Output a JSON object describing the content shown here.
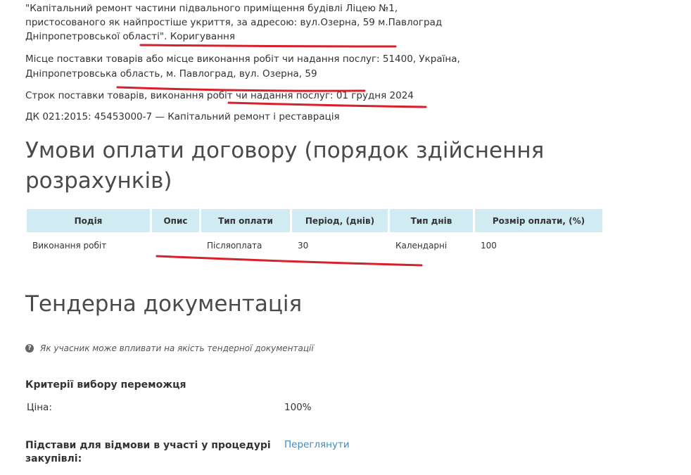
{
  "lot": {
    "title_line1": "\"Капітальний ремонт частини підвального приміщення будівлі Ліцею №1,",
    "title_line2": "пристосованого як найпростіше укриття, за адресою: вул.Озерна, 59 м.Павлоград",
    "title_line3": "Дніпропетровської області\". Коригування",
    "delivery_place_line1": "Місце поставки товарів або місце виконання робіт чи надання послуг: 51400, Україна,",
    "delivery_place_line2": "Дніпропетровська область, м. Павлоград, вул. Озерна, 59",
    "delivery_term": "Строк поставки товарів, виконання робіт чи надання послуг: 01 грудня 2024",
    "classifier": "ДК 021:2015: 45453000-7 — Капітальний ремонт і реставрація"
  },
  "payment": {
    "heading_line1": "Умови оплати договору (порядок здійснення",
    "heading_line2": "розрахунків)",
    "columns": [
      "Подія",
      "Опис",
      "Тип оплати",
      "Період, (днів)",
      "Тип днів",
      "Розмір оплати, (%)"
    ],
    "rows": [
      [
        "Виконання робіт",
        "",
        "Післяоплата",
        "30",
        "Календарні",
        "100"
      ]
    ]
  },
  "tender_docs": {
    "heading": "Тендерна документація",
    "hint": "Як учасник може впливати на якість тендерної документації",
    "hint_icon": "?"
  },
  "criteria": {
    "heading": "Критерії вибору переможця",
    "price_label": "Ціна:",
    "price_value": "100%"
  },
  "refusal": {
    "label_line1": "Підстави для відмови в участі у процедурі",
    "label_line2": "закупівлі:",
    "link": "Переглянути"
  },
  "colors": {
    "table_header_bg": "#d1ebf2",
    "link": "#3a8dc1",
    "underline_marker": "#d8202a"
  }
}
